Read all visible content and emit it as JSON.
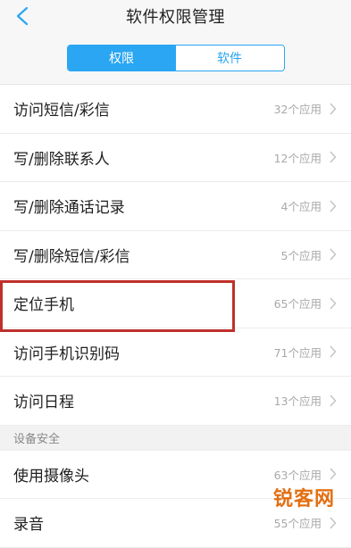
{
  "header": {
    "title": "软件权限管理",
    "back_icon": "chevron-left-icon"
  },
  "segmented": {
    "tabs": [
      {
        "label": "权限",
        "active": true
      },
      {
        "label": "软件",
        "active": false
      }
    ],
    "accent": "#2aa6f2"
  },
  "permissions": [
    {
      "label": "访问短信/彩信",
      "count": "32个应用"
    },
    {
      "label": "写/删除联系人",
      "count": "12个应用"
    },
    {
      "label": "写/删除通话记录",
      "count": "4个应用"
    },
    {
      "label": "写/删除短信/彩信",
      "count": "5个应用"
    },
    {
      "label": "定位手机",
      "count": "65个应用"
    },
    {
      "label": "访问手机识别码",
      "count": "71个应用"
    },
    {
      "label": "访问日程",
      "count": "13个应用"
    }
  ],
  "section": {
    "title": "设备安全"
  },
  "device_permissions": [
    {
      "label": "使用摄像头",
      "count": "63个应用"
    },
    {
      "label": "录音",
      "count": "55个应用"
    }
  ],
  "watermark": "锐客网"
}
